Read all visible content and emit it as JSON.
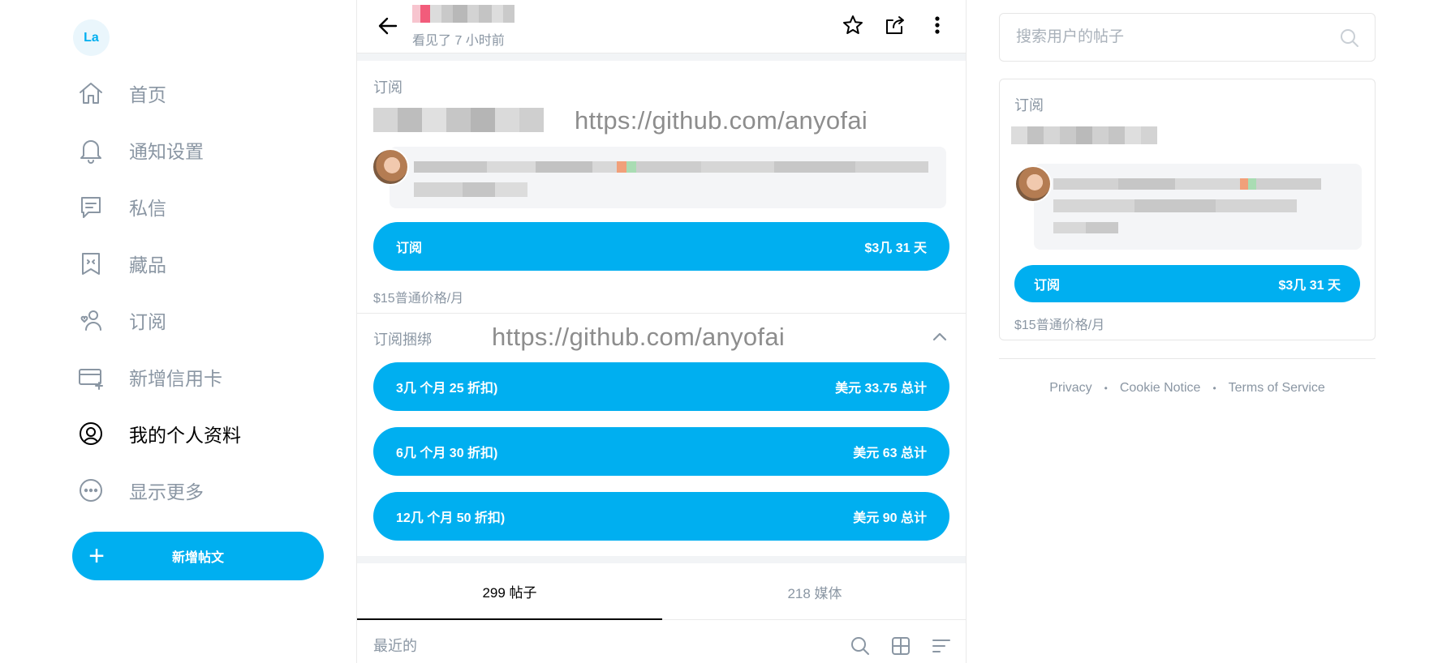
{
  "left_nav": {
    "avatar_initials": "La",
    "items": [
      {
        "label": "首页",
        "icon": "home-icon"
      },
      {
        "label": "通知设置",
        "icon": "bell-icon"
      },
      {
        "label": "私信",
        "icon": "message-icon"
      },
      {
        "label": "藏品",
        "icon": "collections-icon"
      },
      {
        "label": "订阅",
        "icon": "subscriptions-icon"
      },
      {
        "label": "新增信用卡",
        "icon": "add-card-icon"
      },
      {
        "label": "我的个人资料",
        "icon": "profile-icon",
        "active": true
      },
      {
        "label": "显示更多",
        "icon": "more-icon"
      }
    ],
    "new_post_label": "新增帖文"
  },
  "header": {
    "last_seen": "看见了 7 小时前"
  },
  "subscription": {
    "section_label": "订阅",
    "watermark": "https://github.com/anyofai",
    "button_left": "订阅",
    "button_right": "$3几 31 天",
    "regular_price": "$15普通价格/月"
  },
  "bundles": {
    "section_label": "订阅捆绑",
    "watermark": "https://github.com/anyofai",
    "items": [
      {
        "left": "3几 个月 25 折扣)",
        "right": "美元 33.75 总计"
      },
      {
        "left": "6几 个月 30 折扣)",
        "right": "美元 63 总计"
      },
      {
        "left": "12几 个月 50 折扣)",
        "right": "美元 90 总计"
      }
    ]
  },
  "tabs": [
    {
      "label": "299 帖子",
      "active": true
    },
    {
      "label": "218 媒体",
      "active": false
    }
  ],
  "feed": {
    "sort_label": "最近的"
  },
  "sidebar": {
    "search_placeholder": "搜索用户的帖子",
    "card": {
      "section_label": "订阅",
      "button_left": "订阅",
      "button_right": "$3几 31 天",
      "regular_price": "$15普通价格/月"
    },
    "footer_links": [
      "Privacy",
      "Cookie Notice",
      "Terms of Service"
    ],
    "footer_separator": "•"
  },
  "colors": {
    "accent": "#00aff0",
    "muted_text": "#8a96a3",
    "active_text": "#000000"
  }
}
